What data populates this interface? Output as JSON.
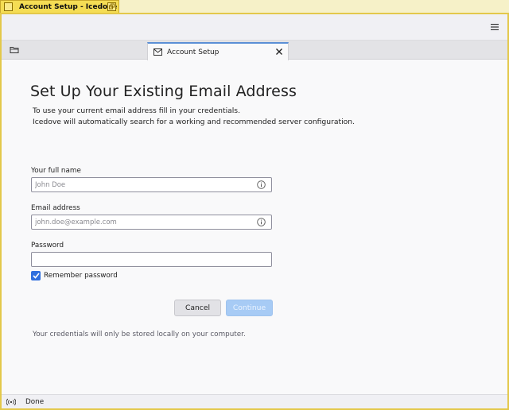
{
  "window": {
    "title": "Account Setup - Icedove"
  },
  "tab": {
    "label": "Account Setup"
  },
  "page": {
    "heading": "Set Up Your Existing Email Address",
    "intro_line1": "To use your current email address fill in your credentials.",
    "intro_line2": "Icedove will automatically search for a working and recommended server configuration."
  },
  "form": {
    "name": {
      "label": "Your full name",
      "placeholder": "John Doe",
      "value": ""
    },
    "email": {
      "label": "Email address",
      "placeholder": "john.doe@example.com",
      "value": ""
    },
    "password": {
      "label": "Password",
      "value": ""
    },
    "remember": {
      "label": "Remember password",
      "checked": true
    }
  },
  "buttons": {
    "cancel": "Cancel",
    "continue": "Continue"
  },
  "footnote": "Your credentials will only be stored locally on your computer.",
  "status": {
    "text": "Done"
  },
  "icons": {
    "menu": "hamburger-menu-icon",
    "folder": "folder-icon",
    "tab": "envelope-icon",
    "close": "close-icon",
    "info": "info-icon",
    "status": "online-status-icon"
  },
  "colors": {
    "accent": "#2f6fde",
    "continue_disabled": "#a7cbf5",
    "titlebar": "#f5dd54"
  }
}
